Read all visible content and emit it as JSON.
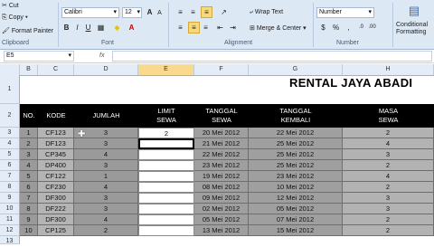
{
  "ribbon": {
    "cut": "Cut",
    "copy": "Copy",
    "format_painter": "Format Painter",
    "clipboard": "Clipboard",
    "font_name": "Calibri",
    "font_size": "12",
    "font_group": "Font",
    "wrap_text": "Wrap Text",
    "merge_center": "Merge & Center",
    "alignment_group": "Alignment",
    "number_format": "Number",
    "number_group": "Number",
    "conditional_formatting": "Conditional Formatting"
  },
  "formula_bar": {
    "name_box": "E5",
    "fx": "fx",
    "value": ""
  },
  "columns": [
    "B",
    "C",
    "D",
    "E",
    "F",
    "G",
    "H"
  ],
  "rows": [
    "1",
    "2",
    "3",
    "4",
    "5",
    "6",
    "7",
    "8",
    "9",
    "10",
    "11",
    "12",
    "13"
  ],
  "sheet": {
    "title": "RENTAL JAYA ABADI",
    "headers": {
      "no": "NO.",
      "kode": "KODE",
      "jumlah": "JUMLAH",
      "limit1": "LIMIT",
      "limit2": "SEWA",
      "tanggal1": "TANGGAL",
      "tanggal2": "SEWA",
      "kembali1": "TANGGAL",
      "kembali2": "KEMBALI",
      "masa1": "MASA",
      "masa2": "SEWA"
    },
    "rows": [
      {
        "no": "1",
        "kode": "CF123",
        "jumlah": "3",
        "limit": "2",
        "tgl": "20 Mei 2012",
        "kembali": "22 Mei 2012",
        "masa": "2"
      },
      {
        "no": "2",
        "kode": "DF123",
        "jumlah": "3",
        "limit": "",
        "tgl": "21 Mei 2012",
        "kembali": "25 Mei 2012",
        "masa": "4"
      },
      {
        "no": "3",
        "kode": "CP345",
        "jumlah": "4",
        "limit": "",
        "tgl": "22 Mei 2012",
        "kembali": "25 Mei 2012",
        "masa": "3"
      },
      {
        "no": "4",
        "kode": "DP400",
        "jumlah": "3",
        "limit": "",
        "tgl": "23 Mei 2012",
        "kembali": "25 Mei 2012",
        "masa": "2"
      },
      {
        "no": "5",
        "kode": "CF122",
        "jumlah": "1",
        "limit": "",
        "tgl": "19 Mei 2012",
        "kembali": "23 Mei 2012",
        "masa": "4"
      },
      {
        "no": "6",
        "kode": "CF230",
        "jumlah": "4",
        "limit": "",
        "tgl": "08 Mei 2012",
        "kembali": "10 Mei 2012",
        "masa": "2"
      },
      {
        "no": "7",
        "kode": "DF300",
        "jumlah": "3",
        "limit": "",
        "tgl": "09 Mei 2012",
        "kembali": "12 Mei 2012",
        "masa": "3"
      },
      {
        "no": "8",
        "kode": "DF222",
        "jumlah": "3",
        "limit": "",
        "tgl": "02 Mei 2012",
        "kembali": "05 Mei 2012",
        "masa": "3"
      },
      {
        "no": "9",
        "kode": "DF300",
        "jumlah": "4",
        "limit": "",
        "tgl": "05 Mei 2012",
        "kembali": "07 Mei 2012",
        "masa": "2"
      },
      {
        "no": "10",
        "kode": "CP125",
        "jumlah": "2",
        "limit": "",
        "tgl": "13 Mei 2012",
        "kembali": "15 Mei 2012",
        "masa": "2"
      }
    ]
  }
}
